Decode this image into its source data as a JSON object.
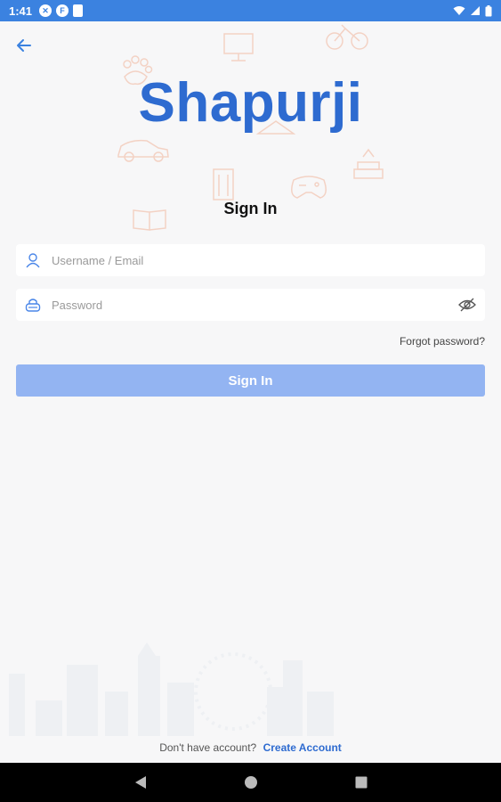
{
  "status_bar": {
    "time": "1:41",
    "icons": [
      "x-circle-icon",
      "f-circle-icon",
      "sd-card-icon",
      "wifi-icon",
      "signal-icon",
      "battery-icon"
    ]
  },
  "brand": {
    "logo_text": "Shapurji",
    "primary_color": "#2e6bd0",
    "button_color": "#93b4f2"
  },
  "form": {
    "title": "Sign In",
    "username": {
      "value": "",
      "placeholder": "Username / Email"
    },
    "password": {
      "value": "",
      "placeholder": "Password"
    },
    "forgot_label": "Forgot password?",
    "submit_label": "Sign In"
  },
  "footer": {
    "prompt": "Don't have account?",
    "create_label": "Create Account"
  },
  "nav": {
    "icons": [
      "back-triangle-icon",
      "home-circle-icon",
      "recents-square-icon"
    ]
  }
}
